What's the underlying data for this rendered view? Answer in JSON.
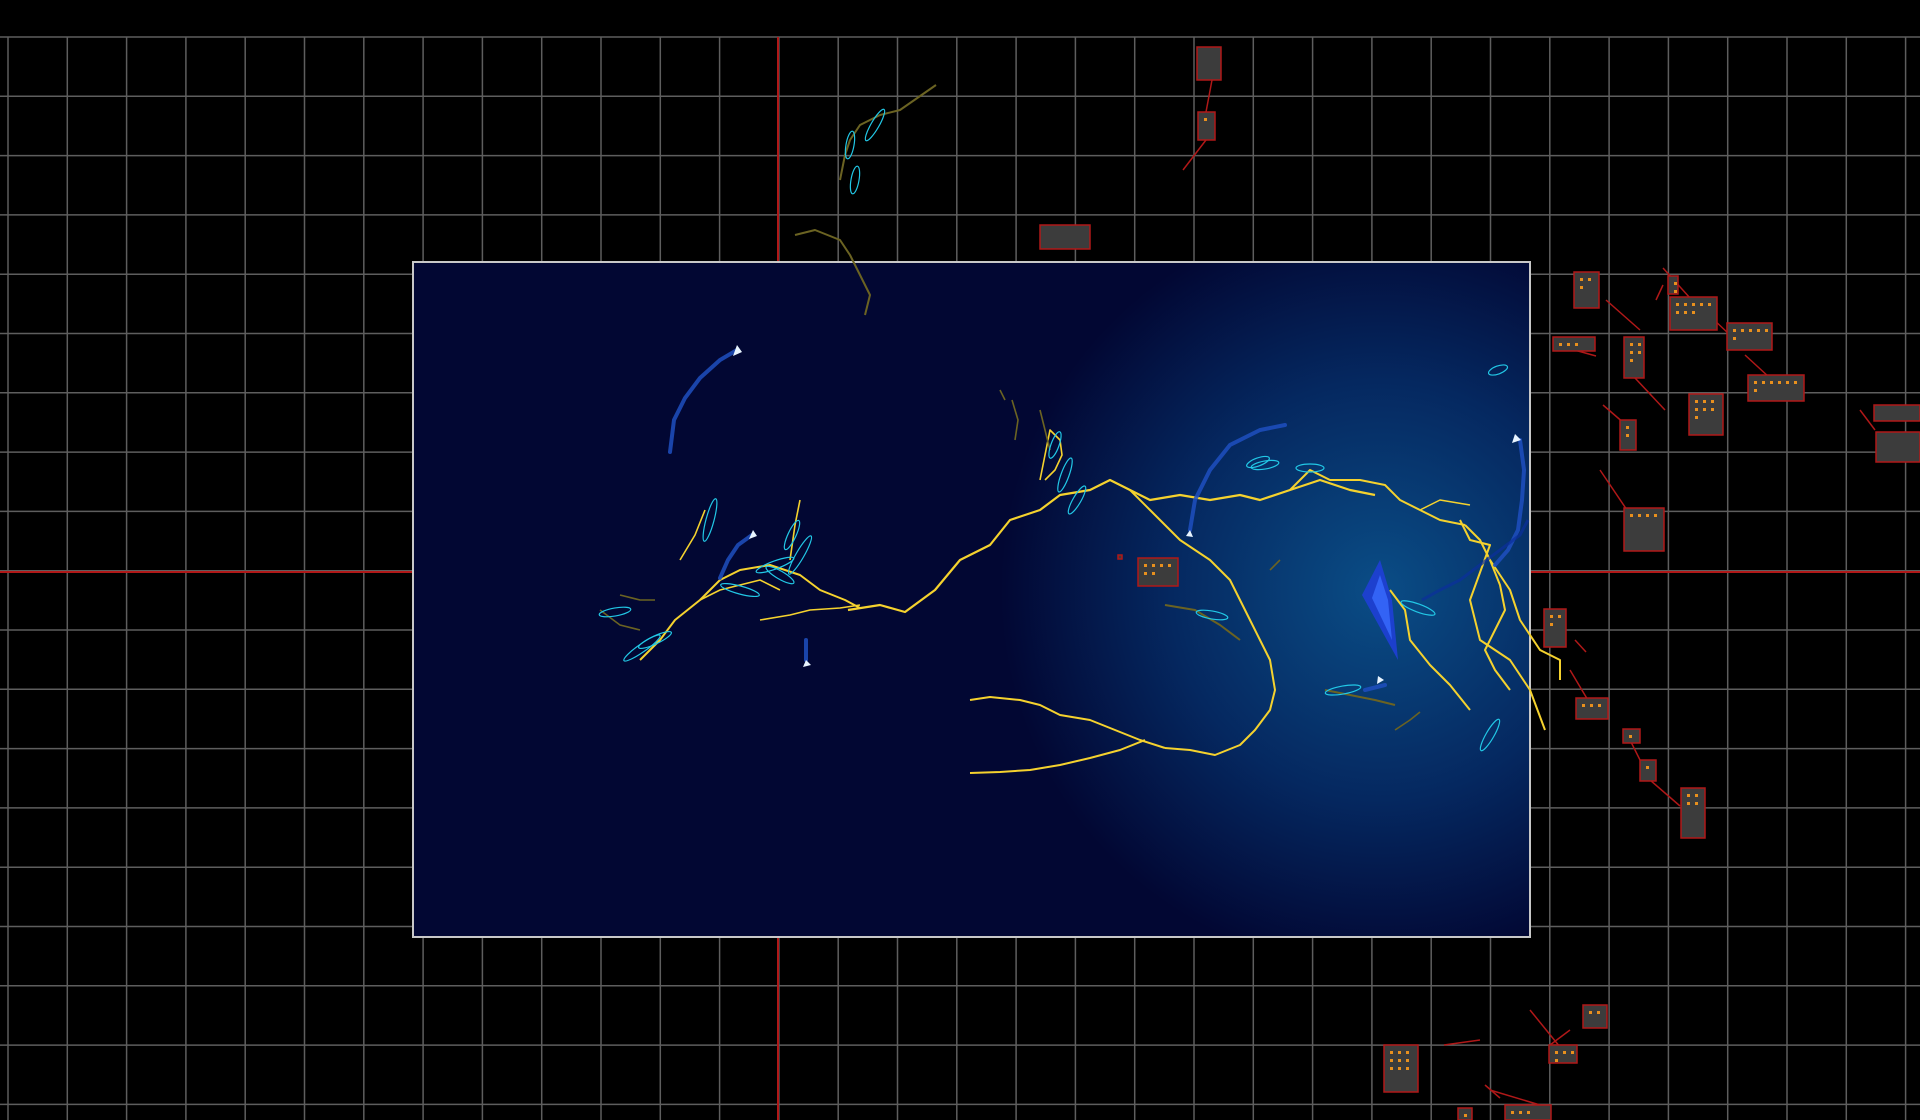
{
  "editor": {
    "grid_visible": true,
    "origin_axes_visible": true,
    "colors": {
      "background": "#000000",
      "grid": "#5e5e5e",
      "axis": "#b01818",
      "viewport_border": "#c8c8c8",
      "viewport_bg": "#020733",
      "glow": "#0a4d86",
      "branch_yellow": "#f5d22e",
      "branch_olive": "#6b6322",
      "branch_cyan": "#22c8e6",
      "crystal_blue": "#1f3fd6",
      "node_fill": "#3c3c3c",
      "node_border": "#b01818",
      "node_pip": "#e8901e"
    }
  },
  "game_view": {
    "effect": "lightning-branches",
    "glow_focus": "right"
  },
  "offscreen_objects": {
    "count": 27
  }
}
